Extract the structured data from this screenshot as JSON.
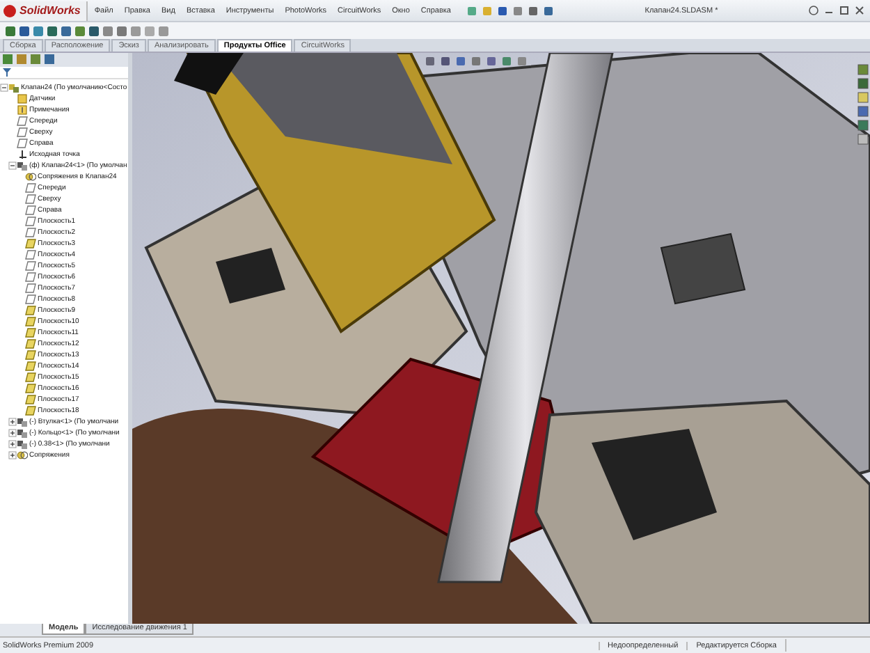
{
  "app": {
    "logo": "SolidWorks"
  },
  "menu": [
    "Файл",
    "Правка",
    "Вид",
    "Вставка",
    "Инструменты",
    "PhotoWorks",
    "CircuitWorks",
    "Окно",
    "Справка"
  ],
  "document_title": "Клапан24.SLDASM *",
  "command_tabs": [
    {
      "label": "Сборка",
      "selected": false
    },
    {
      "label": "Расположение",
      "selected": false
    },
    {
      "label": "Эскиз",
      "selected": false
    },
    {
      "label": "Анализировать",
      "selected": false
    },
    {
      "label": "Продукты Office",
      "selected": true
    },
    {
      "label": "CircuitWorks",
      "selected": false
    }
  ],
  "feature_tree": {
    "items": [
      {
        "kind": "assembly",
        "label": "Клапан24 (По умолчанию<Состо",
        "expanded": true,
        "children": [
          {
            "kind": "sensors",
            "label": "Датчики"
          },
          {
            "kind": "notes",
            "label": "Примечания"
          },
          {
            "kind": "plane",
            "label": "Спереди",
            "shown": false
          },
          {
            "kind": "plane",
            "label": "Сверху",
            "shown": false
          },
          {
            "kind": "plane",
            "label": "Справа",
            "shown": false
          },
          {
            "kind": "origin",
            "label": "Исходная точка"
          },
          {
            "kind": "part",
            "label": "(ф) Клапан24<1> (По умолчан",
            "expanded": true,
            "children": [
              {
                "kind": "mates",
                "label": "Сопряжения в Клапан24"
              },
              {
                "kind": "plane",
                "label": "Спереди",
                "shown": false
              },
              {
                "kind": "plane",
                "label": "Сверху",
                "shown": false
              },
              {
                "kind": "plane",
                "label": "Справа",
                "shown": false
              },
              {
                "kind": "plane",
                "label": "Плоскость1",
                "shown": false
              },
              {
                "kind": "plane",
                "label": "Плоскость2",
                "shown": false
              },
              {
                "kind": "plane",
                "label": "Плоскость3",
                "shown": true
              },
              {
                "kind": "plane",
                "label": "Плоскость4",
                "shown": false
              },
              {
                "kind": "plane",
                "label": "Плоскость5",
                "shown": false
              },
              {
                "kind": "plane",
                "label": "Плоскость6",
                "shown": false
              },
              {
                "kind": "plane",
                "label": "Плоскость7",
                "shown": false
              },
              {
                "kind": "plane",
                "label": "Плоскость8",
                "shown": false
              },
              {
                "kind": "plane",
                "label": "Плоскость9",
                "shown": true
              },
              {
                "kind": "plane",
                "label": "Плоскость10",
                "shown": true
              },
              {
                "kind": "plane",
                "label": "Плоскость11",
                "shown": true
              },
              {
                "kind": "plane",
                "label": "Плоскость12",
                "shown": true
              },
              {
                "kind": "plane",
                "label": "Плоскость13",
                "shown": true
              },
              {
                "kind": "plane",
                "label": "Плоскость14",
                "shown": true
              },
              {
                "kind": "plane",
                "label": "Плоскость15",
                "shown": true
              },
              {
                "kind": "plane",
                "label": "Плоскость16",
                "shown": true
              },
              {
                "kind": "plane",
                "label": "Плоскость17",
                "shown": true
              },
              {
                "kind": "plane",
                "label": "Плоскость18",
                "shown": true
              }
            ]
          },
          {
            "kind": "part",
            "label": "(-) Втулка<1> (По умолчани",
            "expanded": false
          },
          {
            "kind": "part",
            "label": "(-) Кольцо<1> (По умолчани",
            "expanded": false
          },
          {
            "kind": "part",
            "label": "(-) 0.38<1> (По умолчани",
            "expanded": false
          },
          {
            "kind": "mates",
            "label": "Сопряжения",
            "expanded": false
          }
        ]
      }
    ]
  },
  "bottom_tabs": [
    {
      "label": "Модель",
      "selected": true
    },
    {
      "label": "Исследование движения 1",
      "selected": false
    }
  ],
  "status_bar": {
    "left": "SolidWorks Premium 2009",
    "fields": [
      "Недоопределенный",
      "Редактируется Сборка"
    ]
  }
}
